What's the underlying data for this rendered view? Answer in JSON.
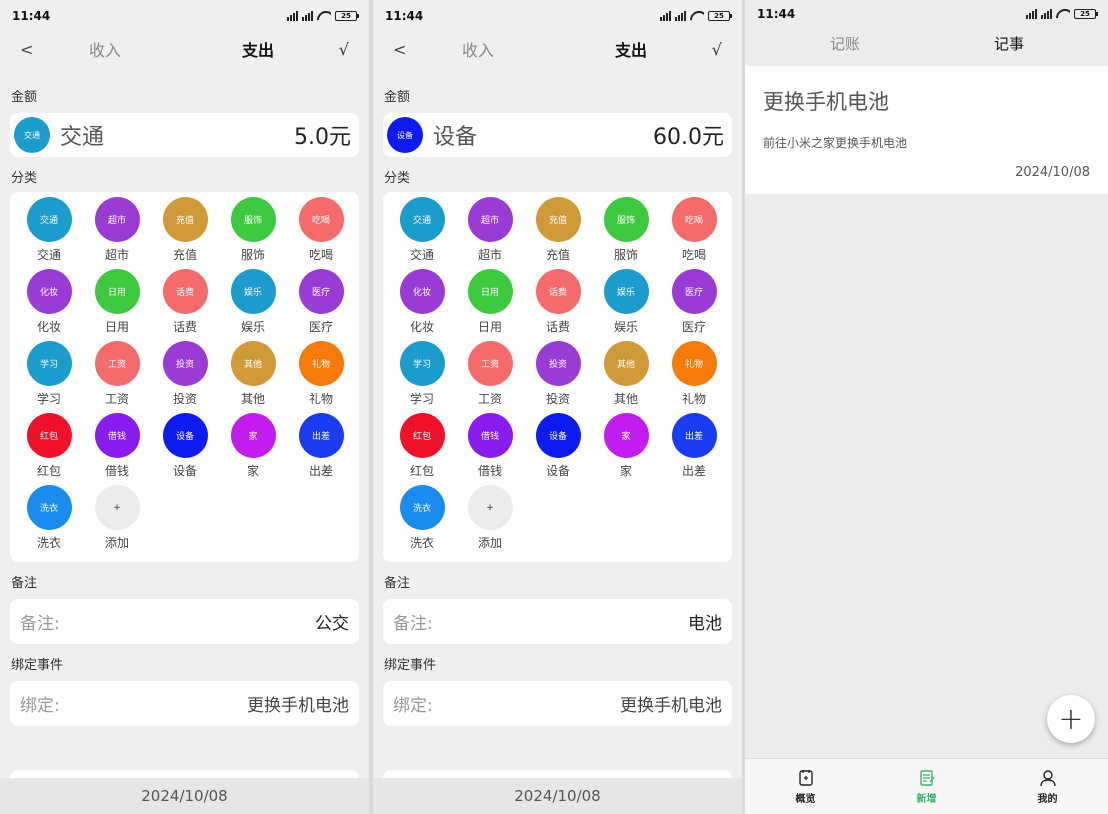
{
  "status": {
    "time": "11:44",
    "battery": "25"
  },
  "colors": {
    "accent_green": "#3cb371"
  },
  "screens": [
    {
      "topbar": {
        "back": "<",
        "income": "收入",
        "expense": "支出",
        "ok": "√"
      },
      "amount_label": "金额",
      "amount": {
        "icon_text": "交通",
        "name": "交通",
        "value": "5.0元",
        "color": "#1a9ccc"
      },
      "category_label": "分类",
      "note_label": "备注",
      "note": {
        "key": "备注:",
        "value": "公交"
      },
      "bind_label": "绑定事件",
      "bind": {
        "key": "绑定:",
        "value": "更换手机电池"
      },
      "date": "2024/10/08"
    },
    {
      "topbar": {
        "back": "<",
        "income": "收入",
        "expense": "支出",
        "ok": "√"
      },
      "amount_label": "金额",
      "amount": {
        "icon_text": "设备",
        "name": "设备",
        "value": "60.0元",
        "color": "#0d1bf0"
      },
      "category_label": "分类",
      "note_label": "备注",
      "note": {
        "key": "备注:",
        "value": "电池"
      },
      "bind_label": "绑定事件",
      "bind": {
        "key": "绑定:",
        "value": "更换手机电池"
      },
      "date": "2024/10/08"
    }
  ],
  "categories": [
    {
      "icon": "交通",
      "label": "交通",
      "color": "#1a9ccc"
    },
    {
      "icon": "超市",
      "label": "超市",
      "color": "#9b3bd6"
    },
    {
      "icon": "充值",
      "label": "充值",
      "color": "#d19a38"
    },
    {
      "icon": "服饰",
      "label": "服饰",
      "color": "#3dc93d"
    },
    {
      "icon": "吃喝",
      "label": "吃喝",
      "color": "#f56b6b"
    },
    {
      "icon": "化妆",
      "label": "化妆",
      "color": "#9b3bd6"
    },
    {
      "icon": "日用",
      "label": "日用",
      "color": "#3dc93d"
    },
    {
      "icon": "话费",
      "label": "话费",
      "color": "#f56b6b"
    },
    {
      "icon": "娱乐",
      "label": "娱乐",
      "color": "#1a9ccc"
    },
    {
      "icon": "医疗",
      "label": "医疗",
      "color": "#9b3bd6"
    },
    {
      "icon": "学习",
      "label": "学习",
      "color": "#1a9ccc"
    },
    {
      "icon": "工资",
      "label": "工资",
      "color": "#f56b6b"
    },
    {
      "icon": "投资",
      "label": "投资",
      "color": "#9b3bd6"
    },
    {
      "icon": "其他",
      "label": "其他",
      "color": "#d19a38"
    },
    {
      "icon": "礼物",
      "label": "礼物",
      "color": "#f57a0a"
    },
    {
      "icon": "红包",
      "label": "红包",
      "color": "#f2112a"
    },
    {
      "icon": "借钱",
      "label": "借钱",
      "color": "#8a1cf0"
    },
    {
      "icon": "设备",
      "label": "设备",
      "color": "#0d1bf0"
    },
    {
      "icon": "家",
      "label": "家",
      "color": "#c21cf0"
    },
    {
      "icon": "出差",
      "label": "出差",
      "color": "#1a3cf0"
    },
    {
      "icon": "洗衣",
      "label": "洗衣",
      "color": "#1a8cf0"
    },
    {
      "icon": "+",
      "label": "添加",
      "color": "#ececec"
    }
  ],
  "notes_screen": {
    "tabs": [
      "记账",
      "记事"
    ],
    "note": {
      "title": "更换手机电池",
      "body": "前往小米之家更换手机电池",
      "date": "2024/10/08"
    },
    "fab": "+",
    "nav": [
      "概览",
      "新增",
      "我的"
    ]
  }
}
